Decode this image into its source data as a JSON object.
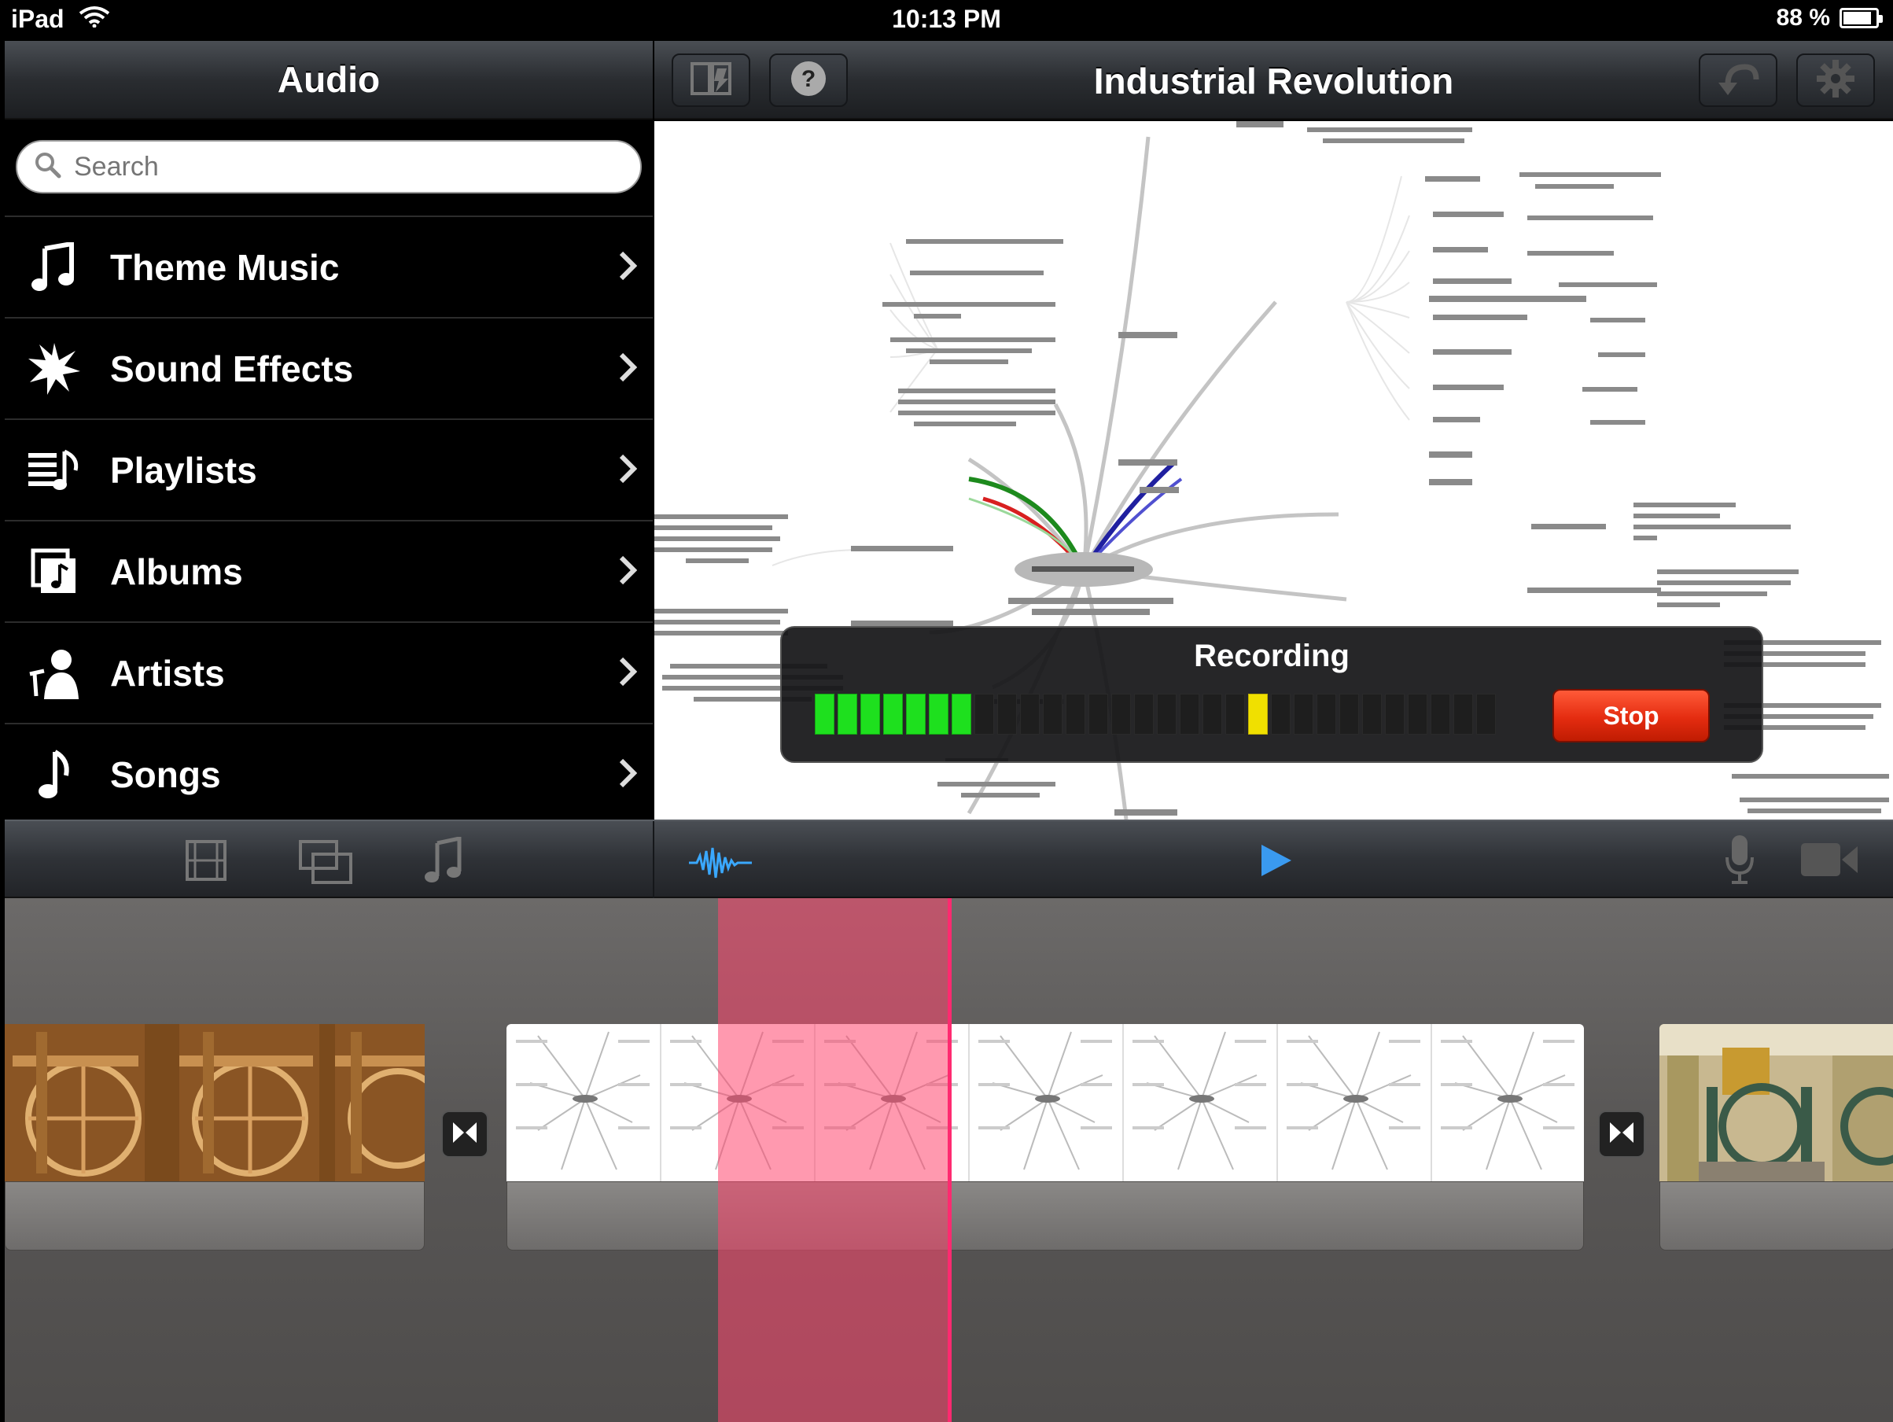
{
  "status_bar": {
    "device": "iPad",
    "time": "10:13 PM",
    "battery_percent": "88 %",
    "battery_level": 0.88
  },
  "left_panel": {
    "title": "Audio",
    "search_placeholder": "Search",
    "items": [
      {
        "label": "Theme Music",
        "icon": "music-note-icon"
      },
      {
        "label": "Sound Effects",
        "icon": "starburst-icon"
      },
      {
        "label": "Playlists",
        "icon": "playlist-icon"
      },
      {
        "label": "Albums",
        "icon": "album-icon"
      },
      {
        "label": "Artists",
        "icon": "artist-icon"
      },
      {
        "label": "Songs",
        "icon": "single-note-icon"
      }
    ]
  },
  "project": {
    "title": "Industrial Revolution",
    "toolbar_left": [
      "my-projects-icon",
      "help-icon"
    ],
    "toolbar_right": [
      "undo-icon",
      "gear-icon"
    ]
  },
  "mindmap": {
    "center": "The Industrial Revolution",
    "branches": [
      "Key Events",
      "Causes",
      "Leaders",
      "Impacts",
      "Leaders ( and their inventions)",
      "Artistic impacts",
      "Social and reformal impacts",
      "The Cottage Industry",
      "New Banking System",
      "Financial Causes that supported the industrial revolution",
      "Main Causes",
      "Citations"
    ],
    "inventors": [
      "Eli Whitney",
      "Francis C. Lowe",
      "Elias Howe",
      "Cyrus McCormick",
      "Samuel F. B. Morse",
      "Thomas Edison",
      "Alexander Bell",
      "Karl Benz"
    ],
    "inventions": [
      "Cotton gin (separation of seeds)",
      "Sewing factory machine",
      "Sewing machine",
      "Reaper / Quick harvest",
      "Telegraph",
      "Light bulb",
      "Telephone",
      "Automobile"
    ],
    "key_events": [
      "Expansion of the Cotton industry",
      "New artistic ideas and changes",
      "Innovative inventions that pulled of a button life",
      "New socio-economic changes and reforms that created a more organized society",
      "Changes in politics that made the government more stable and fair, which changed completely the economy of Europe"
    ]
  },
  "recording": {
    "title": "Recording",
    "stop_label": "Stop",
    "level_fraction": 0.22,
    "peak_fraction": 0.67
  },
  "mid_toolbar": {
    "left_icons": [
      "video-clips-icon",
      "photos-icon",
      "audio-icon"
    ],
    "center_icons": [
      "waveform-icon",
      "play-icon"
    ],
    "right_icons": [
      "microphone-icon",
      "camera-icon"
    ]
  },
  "timeline": {
    "clips": [
      "spinning-wheel-clip",
      "mind-map-clip",
      "steam-engine-clip"
    ],
    "transitions": 2
  },
  "colors": {
    "meter_on": "#1ee01e",
    "meter_peak": "#f0e000",
    "stop_red": "#e42c10",
    "playhead": "#ff2a70",
    "waveform_blue": "#3aa8ff",
    "play_blue": "#3a9af0"
  }
}
